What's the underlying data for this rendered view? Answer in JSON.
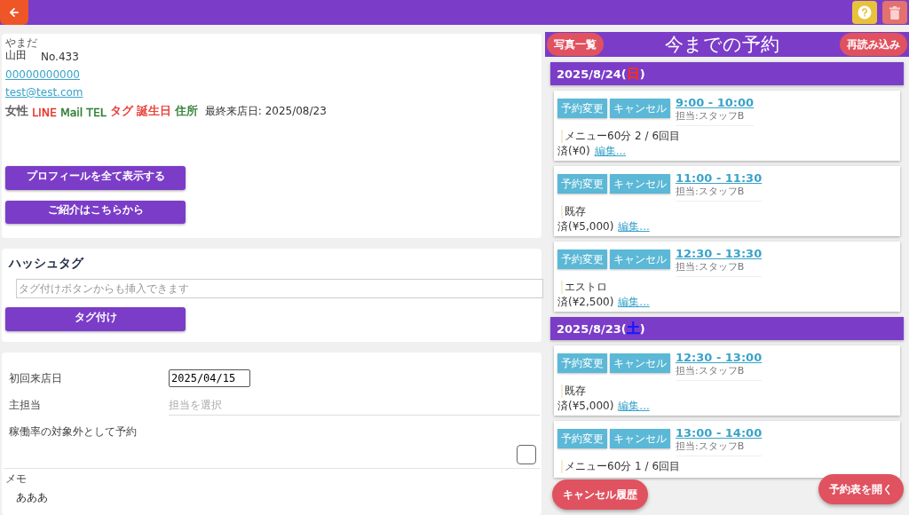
{
  "profile": {
    "reading": "やまだ",
    "name": "山田",
    "number": "No.433",
    "phone": "00000000000",
    "email": "test@test.com",
    "tags": [
      {
        "label": "女性",
        "color": "#555555"
      },
      {
        "label": "LINE",
        "color": "#e8322b"
      },
      {
        "label": "Mail",
        "color": "#2e7d32"
      },
      {
        "label": "TEL",
        "color": "#2e7d32"
      },
      {
        "label": "タグ",
        "color": "#e8322b"
      },
      {
        "label": "誕生日",
        "color": "#e8322b"
      },
      {
        "label": "住所",
        "color": "#2e7d32"
      }
    ],
    "last_visit": "最終来店日: 2025/08/23",
    "buttons": [
      "プロフィールを全て表示する",
      "ご紹介はこちらから"
    ]
  },
  "hashtag": {
    "title": "ハッシュタグ",
    "placeholder": "タグ付けボタンからも挿入できます",
    "button": "タグ付け"
  },
  "form": {
    "first_visit_label": "初回来店日",
    "first_visit": "2025/04/15",
    "staff_label": "主担当",
    "staff_placeholder": "担当を選択",
    "exclude_label": "稼働率の対象外として予約",
    "exclude_checked": false,
    "memo_label": "メモ",
    "memo": "あああ"
  },
  "history": {
    "photos_button": "写真一覧",
    "title": "今までの予約",
    "reload_button": "再読み込み",
    "days": [
      {
        "date": "2025/8/24(",
        "weekday": "日",
        "color": "#e8322b",
        "close": ")",
        "bookings": [
          {
            "change": "予約変更",
            "cancel": "キャンセル",
            "time": "9:00 - 10:00",
            "staff": "担当:スタッフB",
            "menu": "メニュー60分 2 / 6回目",
            "paid": "済(¥0)",
            "edit": "編集..."
          },
          {
            "change": "予約変更",
            "cancel": "キャンセル",
            "time": "11:00 - 11:30",
            "staff": "担当:スタッフB",
            "menu": "既存",
            "paid": "済(¥5,000)",
            "edit": "編集..."
          },
          {
            "change": "予約変更",
            "cancel": "キャンセル",
            "time": "12:30 - 13:30",
            "staff": "担当:スタッフB",
            "menu": "エストロ",
            "paid": "済(¥2,500)",
            "edit": "編集..."
          }
        ]
      },
      {
        "date": "2025/8/23(",
        "weekday": "土",
        "color": "#1a1aff",
        "close": ")",
        "bookings": [
          {
            "change": "予約変更",
            "cancel": "キャンセル",
            "time": "12:30 - 13:00",
            "staff": "担当:スタッフB",
            "menu": "既存",
            "paid": "済(¥5,000)",
            "edit": "編集..."
          },
          {
            "change": "予約変更",
            "cancel": "キャンセル",
            "time": "13:00 - 14:00",
            "staff": "担当:スタッフB",
            "menu": "メニュー60分 1 / 6回目"
          }
        ]
      }
    ]
  },
  "floating_buttons": [
    "キャンセル履歴",
    "予約表を開く"
  ]
}
